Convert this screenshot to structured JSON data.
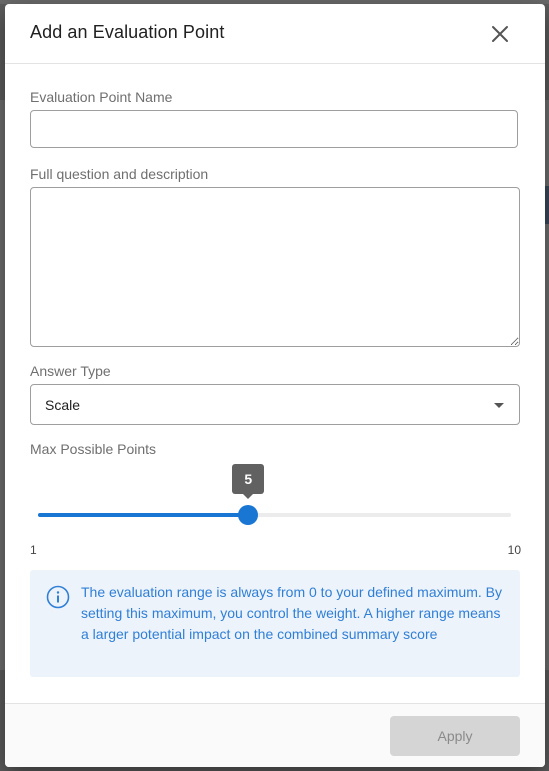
{
  "dialog": {
    "title": "Add an Evaluation Point",
    "close_icon": "close-icon"
  },
  "form": {
    "name_label": "Evaluation Point Name",
    "name_value": "",
    "description_label": "Full question and description",
    "description_value": "",
    "answer_type_label": "Answer Type",
    "answer_type_value": "Scale",
    "max_points_label": "Max Possible Points",
    "slider": {
      "min": 1,
      "max": 10,
      "value": 5,
      "min_label": "1",
      "max_label": "10",
      "value_label": "5"
    }
  },
  "info": {
    "icon": "info-icon",
    "text": "The evaluation range is always from 0 to your defined maximum. By setting this maximum, you control the weight. A higher range means a larger potential impact on the combined summary score"
  },
  "footer": {
    "apply_label": "Apply",
    "apply_enabled": false
  },
  "colors": {
    "accent": "#1976d2",
    "info_bg": "#edf3fb",
    "info_text": "#2f7fd6",
    "disabled_bg": "#d5d5d5"
  }
}
